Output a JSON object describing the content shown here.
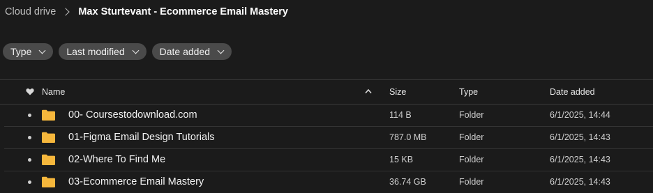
{
  "breadcrumb": {
    "root": "Cloud drive",
    "current": "Max Sturtevant - Ecommerce Email Mastery"
  },
  "filters": [
    {
      "label": "Type"
    },
    {
      "label": "Last modified"
    },
    {
      "label": "Date added"
    }
  ],
  "table": {
    "headers": {
      "name": "Name",
      "size": "Size",
      "type": "Type",
      "date_added": "Date added"
    },
    "sort": {
      "column": "Name",
      "direction": "ascending"
    },
    "rows": [
      {
        "name": "00- Coursestodownload.com",
        "size": "114 B",
        "type": "Folder",
        "date_added": "6/1/2025, 14:44"
      },
      {
        "name": "01-Figma Email Design Tutorials",
        "size": "787.0 MB",
        "type": "Folder",
        "date_added": "6/1/2025, 14:43"
      },
      {
        "name": "02-Where To Find Me",
        "size": "15 KB",
        "type": "Folder",
        "date_added": "6/1/2025, 14:43"
      },
      {
        "name": "03-Ecommerce Email Mastery",
        "size": "36.74 GB",
        "type": "Folder",
        "date_added": "6/1/2025, 14:43"
      }
    ]
  },
  "colors": {
    "background": "#1b1b1b",
    "chip": "#4a4a4a",
    "folder": "#f6b73c"
  },
  "icons": {
    "breadcrumb_separator": "chevron-right-icon",
    "chip_dropdown": "chevron-down-icon",
    "favourite_column": "heart-icon",
    "sort": "sort-ascending-icon",
    "row_item": "folder-icon"
  }
}
